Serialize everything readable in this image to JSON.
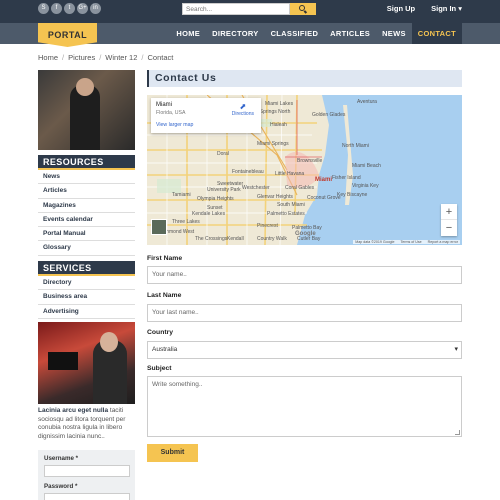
{
  "social": [
    "S",
    "f",
    "t",
    "G+",
    "in"
  ],
  "search": {
    "placeholder": "Search..."
  },
  "top_links": {
    "signup": "Sign Up",
    "signin": "Sign In ▾"
  },
  "logo": "PORTAL",
  "nav": [
    "HOME",
    "DIRECTORY",
    "CLASSIFIED",
    "ARTICLES",
    "NEWS",
    "CONTACT"
  ],
  "breadcrumb": [
    "Home",
    "Pictures",
    "Winter 12",
    "Contact"
  ],
  "resources": {
    "heading": "RESOURCES",
    "items": [
      "News",
      "Articles",
      "Magazines",
      "Events calendar",
      "Portal Manual",
      "Glossary"
    ]
  },
  "services": {
    "heading": "SERVICES",
    "items": [
      "Directory",
      "Business area",
      "Advertising"
    ]
  },
  "side_text": {
    "bold": "Lacinia arcu eget nulla",
    "body": "taciti sociosqu ad litora torquent per conubia nostra ligula in libero dignissim lacinia nunc.."
  },
  "login": {
    "username_label": "Username *",
    "password_label": "Password *"
  },
  "main": {
    "title": "Contact Us",
    "map": {
      "place": "Miami",
      "region": "Florida, USA",
      "directions": "Directions",
      "larger_map": "View larger map",
      "zoom_in": "+",
      "zoom_out": "−",
      "google": "Google",
      "footer": [
        "Map data ©2019 Google",
        "Terms of Use",
        "Report a map error"
      ],
      "labels": [
        "Hialeah",
        "Miami",
        "North Miami",
        "Miami Beach",
        "Miami Springs",
        "Doral",
        "Sweetwater",
        "Coral Gables",
        "Key Biscayne",
        "Westchester",
        "Kendall",
        "Pinecrest",
        "South Miami",
        "Fontainebleau",
        "Miami Lakes",
        "Aventura",
        "Olympia Heights",
        "Tamiami",
        "The Crossings",
        "Country Walk",
        "Palmetto Bay",
        "Cutler Bay",
        "Kendale Lakes",
        "Palmetto Estates",
        "Virginia Key",
        "Golden Glades",
        "Palm Springs North",
        "Brownsville",
        "Fisher Island",
        "Coconut Grove",
        "Glenvar Heights",
        "University Park",
        "Three Lakes",
        "Richmond West",
        "Sunset",
        "Little Havana"
      ]
    },
    "form": {
      "first_name_label": "First Name",
      "first_name_placeholder": "Your name..",
      "last_name_label": "Last Name",
      "last_name_placeholder": "Your last name..",
      "country_label": "Country",
      "country_value": "Australia",
      "subject_label": "Subject",
      "subject_placeholder": "Write something..",
      "submit": "Submit"
    }
  },
  "colors": {
    "dark": "#2e3a4a",
    "nav": "#4d5a6a",
    "accent": "#f5c451",
    "title_bg": "#dfe7f2"
  }
}
